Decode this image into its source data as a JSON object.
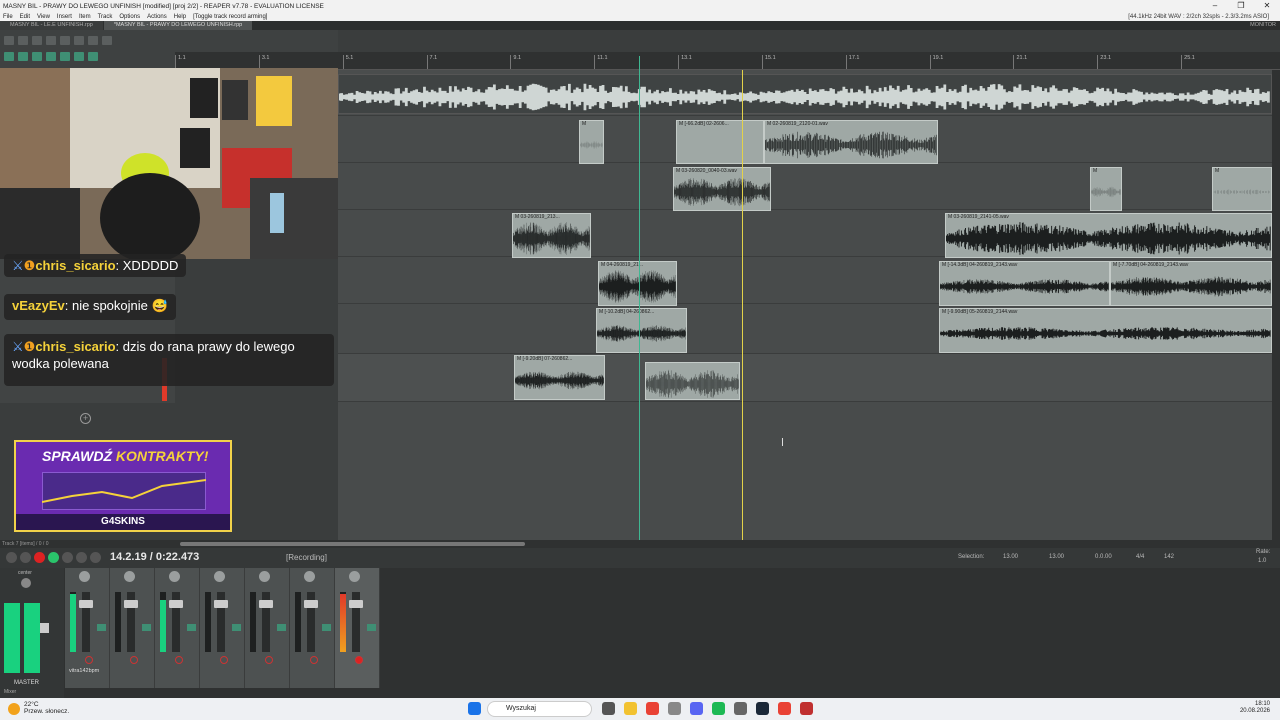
{
  "window": {
    "title": "MASNY BIL - PRAWY DO LEWEGO UNFINISH [modified] [proj 2/2] - REAPER v7.78 - EVALUATION LICENSE",
    "controls": [
      "–",
      "❐",
      "✕"
    ]
  },
  "menu": {
    "items": [
      "File",
      "Edit",
      "View",
      "Insert",
      "Item",
      "Track",
      "Options",
      "Actions",
      "Help",
      "[Toggle track record arming]"
    ],
    "right_info": "[44.1kHz 24bit WAV : 2/2ch 32spls - 2.3/3.2ms ASIO]"
  },
  "tabs": {
    "items": [
      "MASNY BIL - LE.E UNFINISH.rpp",
      "*MASNY BIL - PRAWY DO LEWEGO UNFINISH.rpp"
    ],
    "monitor": "MONITOR"
  },
  "ruler": {
    "marks": [
      "1.1",
      "3.1",
      "5.1",
      "7.1",
      "9.1",
      "11.1",
      "13.1",
      "15.1",
      "17.1",
      "19.1",
      "21.1",
      "23.1",
      "25.1"
    ]
  },
  "items": [
    {
      "label": "M",
      "lane": 1
    },
    {
      "label": "M [-66.2dB] 02-2606...",
      "lane": 1
    },
    {
      "label": "M 02-260819_2120-01.wav",
      "lane": 1
    },
    {
      "label": "M 03-260820_0040-03.wav",
      "lane": 2
    },
    {
      "label": "M",
      "lane": 2
    },
    {
      "label": "M",
      "lane": 2
    },
    {
      "label": "M 03-260819_213...",
      "lane": 3
    },
    {
      "label": "M 03-260819_2141-05.wav",
      "lane": 3
    },
    {
      "label": "M 04-260819_21...",
      "lane": 4
    },
    {
      "label": "M [-14.3dB] 04-260819_2143.wav",
      "lane": 4
    },
    {
      "label": "M [-7.70dB] 04-260819_2143.wav",
      "lane": 4
    },
    {
      "label": "M [-10.2dB] 04-260862...",
      "lane": 5
    },
    {
      "label": "M [-9.90dB] 05-260819_2144.wav",
      "lane": 5
    },
    {
      "label": "M [-9.20dB] 07-260862...",
      "lane": 6
    },
    {
      "label": "",
      "lane": 6
    }
  ],
  "chat": [
    {
      "user": "chris_sicario",
      "text": ": XDDDDD"
    },
    {
      "user": "vEazyEv",
      "text": ": nie spokojnie 😅"
    },
    {
      "user": "chris_sicario",
      "text": ": dzis do rana prawy do lewego wodka polewana"
    }
  ],
  "promo": {
    "headline1": "SPRAWDŹ ",
    "headline2": "KONTRAKTY!",
    "brand": "G4SKINS"
  },
  "track_status": "Track 7 [items] / 0 / 0",
  "transport": {
    "time": "14.2.19 / 0:22.473",
    "status": "[Recording]",
    "selection_label": "Selection:",
    "sel_start": "13.00",
    "sel_end": "13.00",
    "sel_len": "0.0.00",
    "time_sig": "4/4",
    "bpm": "142",
    "rate_label": "Rate:",
    "rate": "1.0"
  },
  "mixer": {
    "master_label": "MASTER",
    "master_center": "center",
    "track_name": "vitra142bpm",
    "mixer_tab": "Mixer"
  },
  "taskbar": {
    "weather_temp": "22°C",
    "weather_desc": "Przew. słonecz.",
    "search_placeholder": "Wyszukaj",
    "time": "18:10",
    "date": "20.08.2026"
  },
  "colors": {
    "arrange_bg": "#484b4b",
    "item_bg": "#9fa8a5",
    "meter_green": "#19d17f",
    "play_cursor": "#3fb892",
    "edit_cursor": "#e3d24a"
  }
}
